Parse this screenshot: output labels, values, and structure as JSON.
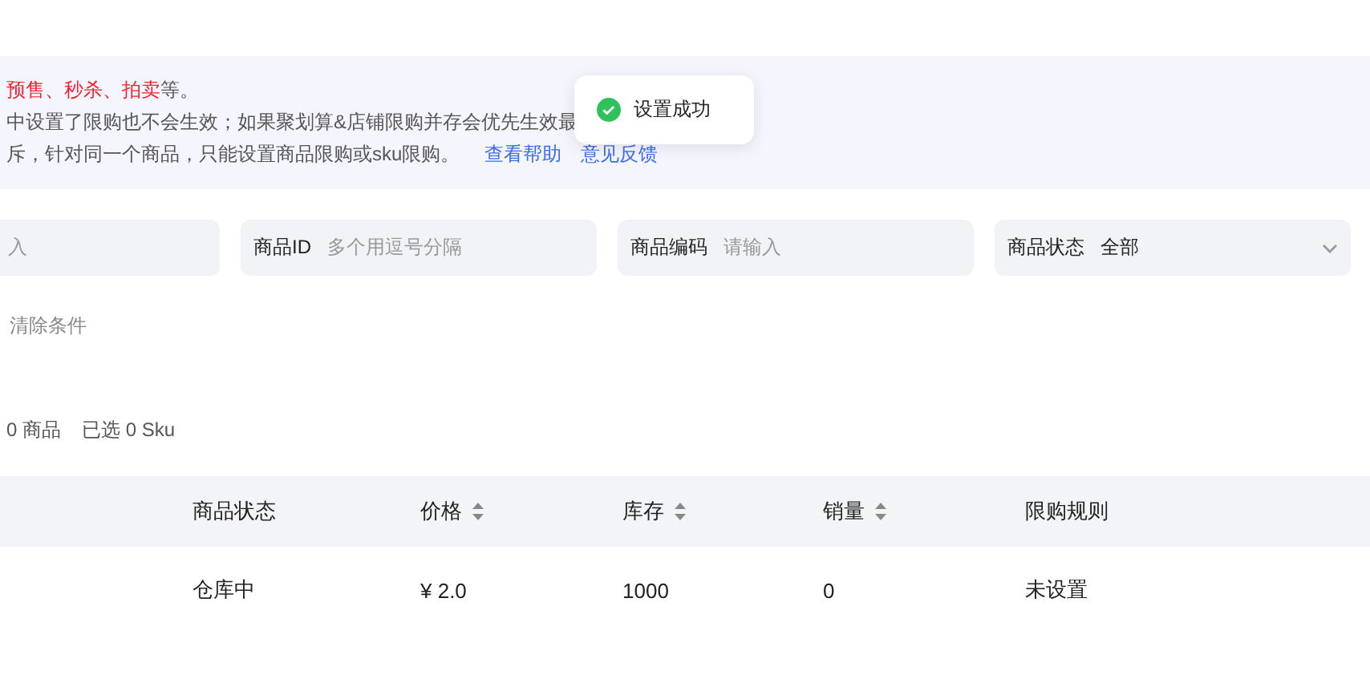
{
  "notice": {
    "line_1": {
      "highlight": "预售、秒杀、拍卖",
      "rest": "等。"
    },
    "line_2": "中设置了限购也不会生效；如果聚划算&店铺限购并存会优先生效最",
    "line_3": "斥，针对同一个商品，只能设置商品限购或sku限购。",
    "links": [
      "查看帮助",
      "意见反馈"
    ]
  },
  "toast": {
    "kind": "success",
    "text": "设置成功"
  },
  "filters": [
    {
      "kind": "input",
      "placeholder": "入"
    },
    {
      "kind": "input",
      "label": "商品ID",
      "placeholder": "多个用逗号分隔"
    },
    {
      "kind": "input",
      "label": "商品编码",
      "placeholder": "请输入"
    },
    {
      "kind": "select",
      "label": "商品状态",
      "value": "全部"
    }
  ],
  "clear_button": "清除条件",
  "selection": [
    "0 商品",
    "已选 0 Sku"
  ],
  "table": {
    "columns": [
      {
        "label": "商品状态",
        "sortable": false
      },
      {
        "label": "价格",
        "sortable": true
      },
      {
        "label": "库存",
        "sortable": true
      },
      {
        "label": "销量",
        "sortable": true
      },
      {
        "label": "限购规则",
        "sortable": false
      }
    ],
    "rows": [
      [
        "仓库中",
        "¥ 2.0",
        "1000",
        "0",
        "未设置"
      ]
    ]
  }
}
